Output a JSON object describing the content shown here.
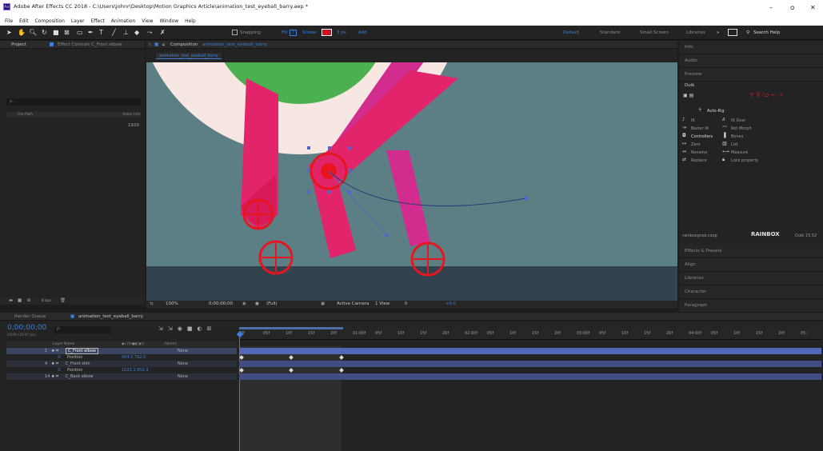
{
  "app": {
    "icon_label": "Ae",
    "title": "Adobe After Effects CC 2018 - C:\\Users\\johnr\\Desktop\\Motion Graphics Article\\animation_test_eyeball_barry.aep *",
    "window_controls": {
      "minimize": "–",
      "maximize": "ᴑ",
      "close": "✕"
    }
  },
  "menu": [
    "File",
    "Edit",
    "Composition",
    "Layer",
    "Effect",
    "Animation",
    "View",
    "Window",
    "Help"
  ],
  "toolbar": {
    "snapping": "Snapping",
    "fill": "Fill",
    "stroke": "Stroke",
    "stroke_width": "3 px",
    "add": "Add",
    "workspaces": [
      "Default",
      "Standard",
      "Small Screen",
      "Libraries"
    ],
    "search_placeholder": "Search Help"
  },
  "project": {
    "tab_project": "Project",
    "tab_effect_controls": "Effect Controls C_Front elbow",
    "search_glyph": "ρ.",
    "col_file_path": "File Path",
    "col_video_info": "Video Info",
    "video_info_value": "1920"
  },
  "composition": {
    "tab_label": "Composition",
    "comp_name": "animation_test_eyeball_barry",
    "breadcrumb": "animation_test_eyeball_barry",
    "footer": {
      "zoom": "100%",
      "timecode": "0;00;00;00",
      "resolution": "(Full)",
      "camera": "Active Camera",
      "view": "1 View",
      "exposure": "+0.0",
      "bpc": "8 bpc"
    }
  },
  "right_panels": {
    "top": [
      "Info",
      "Audio",
      "Preview"
    ],
    "duik": {
      "title": "Duik",
      "autorig": "Auto-Rig",
      "items": [
        {
          "label": "IK",
          "icon": "ik-icon"
        },
        {
          "label": "IK Goal",
          "icon": "ik-goal-icon"
        },
        {
          "label": "Bezier IK",
          "icon": "bezier-ik-icon"
        },
        {
          "label": "Rot Morph",
          "icon": "rot-morph-icon"
        },
        {
          "label": "Controllers",
          "icon": "controllers-icon"
        },
        {
          "label": "Bones",
          "icon": "bones-icon"
        },
        {
          "label": "Zero",
          "icon": "zero-icon"
        },
        {
          "label": "List",
          "icon": "list-icon"
        },
        {
          "label": "Rename",
          "icon": "rename-icon"
        },
        {
          "label": "Measure",
          "icon": "measure-icon"
        },
        {
          "label": "Replace",
          "icon": "replace-icon"
        },
        {
          "label": "Lock property",
          "icon": "lock-icon"
        }
      ],
      "footer_left": "rainboxprod.coop",
      "footer_logo": "RAINBOX",
      "version": "Duik 15.52"
    },
    "bottom": [
      "Effects & Presets",
      "Align",
      "Libraries",
      "Character",
      "Paragraph"
    ]
  },
  "timeline": {
    "tab_render": "Render Queue",
    "tab_comp": "animation_test_eyeball_barry",
    "timecode": "0;00;00;00",
    "timecode_sub": "00000 (29.97 fps)",
    "col_layer_name": "Layer Name",
    "col_parent": "Parent",
    "layers": [
      {
        "num": "1",
        "name": "C_Front elbow",
        "parent": "None",
        "prop": "Position",
        "value": "904.5,762.0"
      },
      {
        "num": "4",
        "name": "C_Front shin",
        "parent": "None",
        "prop": "Position",
        "value": "1023.3,959.3"
      },
      {
        "num": "14",
        "name": "C_Back elbow",
        "parent": "None"
      }
    ],
    "ruler": [
      "0f",
      "05f",
      "10f",
      "15f",
      "20f",
      "01:00f",
      "05f",
      "10f",
      "15f",
      "20f",
      "02:00f",
      "05f",
      "10f",
      "15f",
      "20f",
      "03:00f",
      "05f",
      "10f",
      "15f",
      "20f",
      "04:00f",
      "05f",
      "10f",
      "15f",
      "20f",
      "05:"
    ]
  },
  "colors": {
    "accent_blue": "#3d7ed9",
    "comp_bg": "#5c7f86",
    "character_pink": "#e2246b",
    "character_magenta": "#d12c8e",
    "eye_green": "#4caf50",
    "controller_red": "#e8151f"
  }
}
